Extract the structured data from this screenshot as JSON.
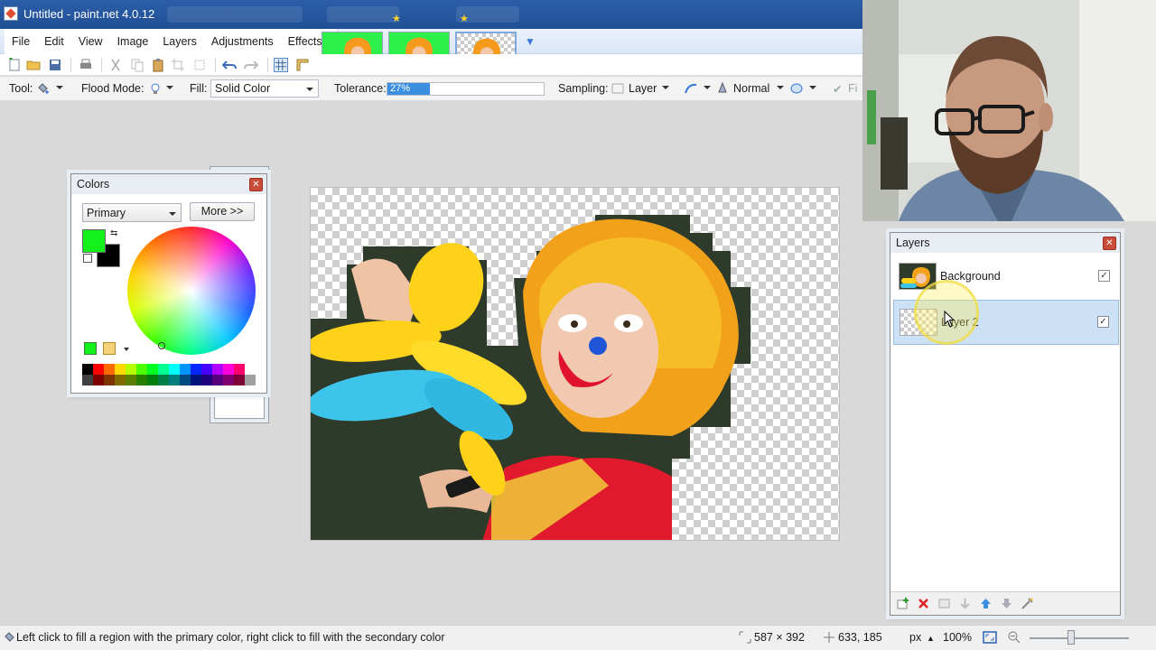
{
  "window": {
    "title": "Untitled - paint.net 4.0.12"
  },
  "menu": {
    "items": [
      "File",
      "Edit",
      "View",
      "Image",
      "Layers",
      "Adjustments",
      "Effects"
    ]
  },
  "tool_options": {
    "tool_label": "Tool:",
    "flood_mode_label": "Flood Mode:",
    "fill_label": "Fill:",
    "fill_value": "Solid Color",
    "tolerance_label": "Tolerance:",
    "tolerance_value": "27%",
    "tolerance_fraction": 0.27,
    "sampling_label": "Sampling:",
    "sampling_value": "Layer",
    "blend_value": "Normal",
    "finish_label": "Fi"
  },
  "colors_window": {
    "title": "Colors",
    "selector": "Primary",
    "more_button": "More >>",
    "primary_color": "#13f01a",
    "secondary_color": "#000000",
    "palette": [
      "#000000",
      "#ff0000",
      "#ff6a00",
      "#ffd800",
      "#b6ff00",
      "#4cff00",
      "#00ff21",
      "#00ff90",
      "#00ffff",
      "#0094ff",
      "#0026ff",
      "#4800ff",
      "#b200ff",
      "#ff00dc",
      "#ff006e",
      "#ffffff",
      "#404040",
      "#7f0000",
      "#7f3300",
      "#7f6a00",
      "#5b7f00",
      "#267f00",
      "#007f0e",
      "#007f46",
      "#007f7f",
      "#004a7f",
      "#00137f",
      "#21007f",
      "#57007f",
      "#7f006e",
      "#7f0037",
      "#a0a0a0"
    ]
  },
  "layers_window": {
    "title": "Layers",
    "layers": [
      {
        "name": "Background",
        "visible": true
      },
      {
        "name": "Layer 2",
        "visible": true,
        "selected": true
      }
    ]
  },
  "status": {
    "hint": "Left click to fill a region with the primary color, right click to fill with the secondary color",
    "image_size": "587 × 392",
    "cursor_pos": "633, 185",
    "unit": "px",
    "zoom": "100%"
  }
}
